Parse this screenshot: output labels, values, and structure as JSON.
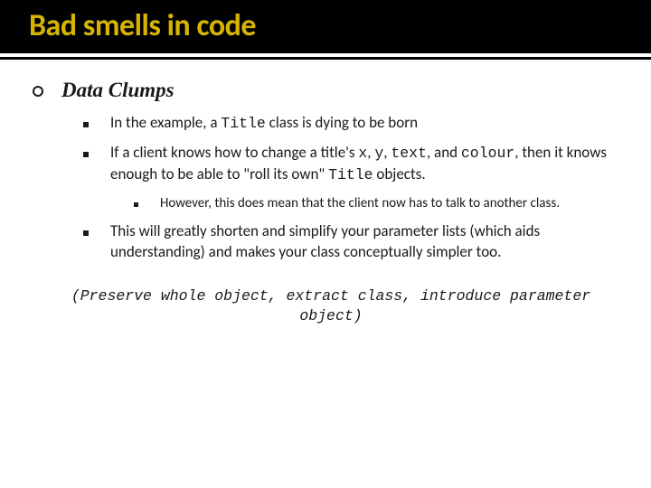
{
  "slide": {
    "title": "Bad smells in code",
    "heading": "Data Clumps",
    "points": [
      {
        "prefix": "In the example, a ",
        "code1": "Title",
        "suffix": " class is dying to be born"
      },
      {
        "prefix": "If a client knows how to change a title's ",
        "code1": "x",
        "mid1": ", ",
        "code2": "y",
        "mid2": ", ",
        "code3": "text",
        "mid3": ", and ",
        "code4": "colour",
        "mid4": ", then it knows enough to be able to \"roll its own\" ",
        "code5": "Title",
        "suffix": " objects."
      },
      {
        "text": "However, this does mean that the client now has to talk to another class."
      },
      {
        "text": "This will greatly shorten and simplify your parameter lists (which aids understanding) and makes your class conceptually simpler too."
      }
    ],
    "footer": "(Preserve whole object, extract class, introduce parameter object)"
  }
}
